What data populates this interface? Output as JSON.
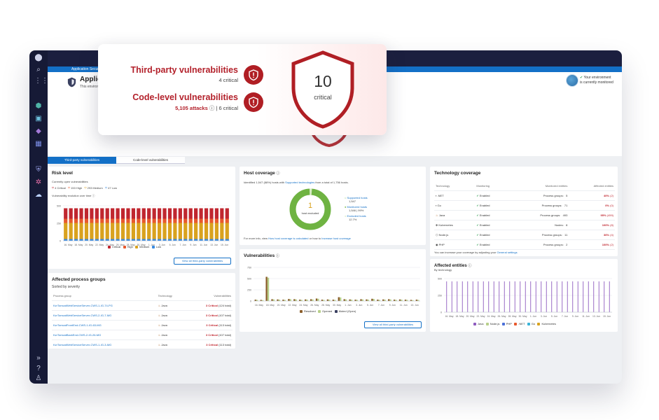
{
  "window": {
    "breadcrumb": "Application Security overview",
    "page_title": "Application",
    "page_subtitle": "This environment's securi",
    "env_status": "Your environment is currently monitored"
  },
  "callout": {
    "third_party": {
      "title": "Third-party vulnerabilities",
      "count_text": "4 critical"
    },
    "code_level": {
      "title": "Code-level vulnerabilities",
      "attacks_text": "5,105 attacks",
      "critical_text": "| 6 critical"
    },
    "total": {
      "number": "10",
      "label": "critical"
    }
  },
  "tabs": [
    {
      "label": "Third-party vulnerabilities"
    },
    {
      "label": "Code-level vulnerabilities"
    }
  ],
  "risk_level": {
    "title": "Risk level",
    "currently_open": "Currently open vulnerabilities",
    "counts": [
      "4 Critical",
      "153 High",
      "293 Medium",
      "47 Low"
    ],
    "evolution_label": "Vulnerability evolution over time",
    "button": "View all third-party vulnerabilities",
    "legend": [
      "Critical",
      "High",
      "Medium",
      "Low"
    ]
  },
  "host_coverage": {
    "title": "Host coverage",
    "identified_prefix": "Identified 1,547 (88%) hosts with",
    "identified_link": "Supported technologies",
    "identified_suffix": "from a total of 1,756 hosts.",
    "donut_number": "1",
    "donut_label": "host excluded",
    "supported_label": "Supported hosts",
    "supported_value": "1,547",
    "monitored_label": "Monitored hosts",
    "monitored_value": "1,546 | 99%",
    "excluded_label": "Excluded hosts",
    "excluded_value": "12.7%",
    "info_prefix": "For more info, view",
    "info_link1": "How host coverage is calculated",
    "info_mid": "or how to",
    "info_link2": "Increase host coverage"
  },
  "technology_coverage": {
    "title": "Technology coverage",
    "headers": [
      "Technology",
      "Monitoring",
      "Monitored entities",
      "Affected entities"
    ],
    "rows": [
      {
        "tech": ".NET",
        "monitoring": "Enabled",
        "entities_label": "Process groups:",
        "entities": "5",
        "affected_pct": "40%",
        "affected_count": "(2)"
      },
      {
        "tech": "Go",
        "monitoring": "Enabled",
        "entities_label": "Process groups:",
        "entities": "71",
        "affected_pct": "0%",
        "affected_count": "(0)"
      },
      {
        "tech": "Java",
        "monitoring": "Enabled",
        "entities_label": "Process groups:",
        "entities": "493",
        "affected_pct": "95%",
        "affected_count": "(459)"
      },
      {
        "tech": "Kubernetes",
        "monitoring": "Enabled",
        "entities_label": "Nodes:",
        "entities": "8",
        "affected_pct": "100%",
        "affected_count": "(8)"
      },
      {
        "tech": "Node.js",
        "monitoring": "Enabled",
        "entities_label": "Process groups:",
        "entities": "11",
        "affected_pct": "36%",
        "affected_count": "(4)"
      },
      {
        "tech": "PHP",
        "monitoring": "Enabled",
        "entities_label": "Process groups:",
        "entities": "2",
        "affected_pct": "100%",
        "affected_count": "(2)"
      }
    ],
    "footnote_prefix": "You can increase your coverage by adjusting your",
    "footnote_link": "General settings"
  },
  "vulnerabilities_panel": {
    "title": "Vulnerabilities",
    "button": "View all third-party vulnerabilities",
    "legend": [
      "Resolved",
      "Opened",
      "Muted (Open)"
    ]
  },
  "affected_process_groups": {
    "title": "Affected process groups",
    "subtitle": "Sorted by severity",
    "headers": [
      "Process group",
      "Technology",
      "Vulnerabilities"
    ],
    "rows": [
      {
        "name": "KzrTomcatWebServiceServer-CWS-1-IG-74-PG",
        "tech": "Java",
        "critical": "3 Critical",
        "total": "(124 total)"
      },
      {
        "name": "KzrTomcatWebServiceServer-CWS-2-IG-7-MG",
        "tech": "Java",
        "critical": "3 Critical",
        "total": "(107 total)"
      },
      {
        "name": "KzrTomcatFrontEnd-CWS-1-IG-63-MG",
        "tech": "Java",
        "critical": "3 Critical",
        "total": "(113 total)"
      },
      {
        "name": "KzrTomcatBackEnd-CWS-2-IG-26-MG",
        "tech": "Java",
        "critical": "3 Critical",
        "total": "(107 total)"
      },
      {
        "name": "KzrTomcatWebServiceServer-CWS-1-IG-3-MG",
        "tech": "Java",
        "critical": "3 Critical",
        "total": "(113 total)"
      }
    ]
  },
  "affected_entities": {
    "title": "Affected entities",
    "subtitle": "By technology",
    "legend": [
      "Java",
      "Node.js",
      "PHP",
      ".NET",
      "Go",
      "Kubernetes"
    ]
  },
  "colors": {
    "critical": "#c0262f",
    "high": "#e8592d",
    "medium": "#d9a21e",
    "low": "#3b8be0",
    "accent": "#1370c7",
    "resolved": "#8b5e2b",
    "opened": "#b8d08a",
    "entities_bar": "#8e5bbf"
  },
  "chart_data": [
    {
      "type": "bar",
      "title": "Vulnerability evolution over time",
      "x_ticks": [
        "16. May",
        "18. May",
        "20. May",
        "22. May",
        "24. May",
        "26. May",
        "28. May",
        "30. May",
        "1. Jun",
        "3. Jun",
        "5. Jun",
        "7. Jun",
        "9. Jun",
        "11. Jun",
        "13. Jun",
        "15. Jun"
      ],
      "ylim": [
        0,
        500
      ],
      "y_ticks": [
        "0",
        "250",
        "500"
      ],
      "series": [
        {
          "name": "Critical",
          "values": [
            150,
            150,
            150,
            150,
            150,
            150,
            150,
            150,
            150,
            150,
            150,
            150,
            150,
            150,
            150,
            150,
            150,
            150,
            150,
            150,
            150,
            150,
            150,
            150,
            150,
            150,
            150,
            150,
            150,
            150,
            150,
            150
          ]
        },
        {
          "name": "High",
          "values": [
            60,
            60,
            60,
            60,
            60,
            60,
            60,
            60,
            60,
            60,
            60,
            60,
            60,
            60,
            60,
            60,
            60,
            60,
            60,
            60,
            60,
            60,
            60,
            60,
            60,
            60,
            60,
            60,
            60,
            60,
            60,
            60
          ]
        },
        {
          "name": "Medium",
          "values": [
            230,
            230,
            230,
            230,
            230,
            230,
            230,
            230,
            230,
            230,
            230,
            230,
            230,
            230,
            230,
            230,
            230,
            230,
            230,
            230,
            230,
            230,
            230,
            230,
            230,
            230,
            230,
            230,
            230,
            230,
            230,
            230
          ]
        },
        {
          "name": "Low",
          "values": [
            25,
            25,
            25,
            25,
            25,
            25,
            25,
            25,
            25,
            25,
            25,
            25,
            25,
            25,
            25,
            25,
            25,
            25,
            25,
            25,
            25,
            25,
            25,
            25,
            25,
            25,
            25,
            25,
            25,
            25,
            25,
            25
          ]
        }
      ]
    },
    {
      "type": "bar",
      "title": "Vulnerabilities",
      "x_ticks": [
        "16. May",
        "18. May",
        "20. May",
        "22. May",
        "24. May",
        "26. May",
        "28. May",
        "30. May",
        "1. Jun",
        "3. Jun",
        "5. Jun",
        "7. Jun",
        "9. Jun",
        "11. Jun",
        "13. Jun"
      ],
      "ylim": [
        0,
        750
      ],
      "y_ticks": [
        "0",
        "250",
        "500",
        "750"
      ],
      "series": [
        {
          "name": "Resolved",
          "values": [
            30,
            25,
            540,
            40,
            35,
            30,
            45,
            40,
            30,
            35,
            40,
            55,
            30,
            35,
            30,
            85,
            40,
            35,
            30,
            40,
            35,
            50,
            30,
            35,
            40,
            30,
            35,
            30,
            25,
            30
          ]
        },
        {
          "name": "Opened",
          "values": [
            25,
            20,
            520,
            35,
            30,
            25,
            40,
            35,
            25,
            30,
            35,
            50,
            25,
            30,
            25,
            80,
            35,
            30,
            25,
            35,
            30,
            45,
            25,
            30,
            35,
            25,
            30,
            25,
            20,
            25
          ]
        }
      ]
    },
    {
      "type": "bar",
      "title": "Affected entities",
      "x_ticks": [
        "16. May",
        "18. May",
        "20. May",
        "22. May",
        "24. May",
        "26. May",
        "28. May",
        "30. May",
        "1. Jun",
        "3. Jun",
        "5. Jun",
        "7. Jun",
        "9. Jun",
        "11. Jun",
        "13. Jun",
        "15. Jun"
      ],
      "ylim": [
        0,
        500
      ],
      "y_ticks": [
        "0",
        "250",
        "500"
      ],
      "series": [
        {
          "name": "Java",
          "values": [
            459,
            459,
            459,
            459,
            459,
            459,
            459,
            459,
            459,
            459,
            459,
            459,
            459,
            459,
            459,
            459,
            459,
            459,
            459,
            459,
            459,
            459,
            459,
            459,
            459,
            459,
            459,
            459,
            459,
            459,
            459,
            459
          ]
        }
      ]
    }
  ]
}
